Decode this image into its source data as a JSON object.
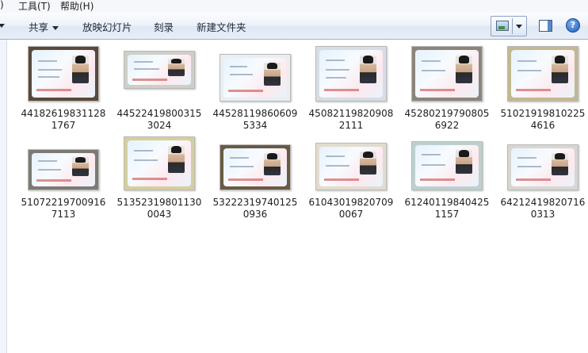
{
  "menu": [
    ")",
    "工具(T)",
    "帮助(H)"
  ],
  "toolbar": {
    "share_label": "共享",
    "slideshow_label": "放映幻灯片",
    "burn_label": "刻录",
    "new_folder_label": "新建文件夹",
    "help_glyph": "?"
  },
  "files": [
    {
      "name": "441826198311281767"
    },
    {
      "name": "445224198003153024"
    },
    {
      "name": "445281198606095334"
    },
    {
      "name": "450821198209082111"
    },
    {
      "name": "452802197908056922"
    },
    {
      "name": "510219198102254616"
    },
    {
      "name": "510722197009167113"
    },
    {
      "name": "513523198011300043"
    },
    {
      "name": "532223197401250936"
    },
    {
      "name": "610430198207090067"
    },
    {
      "name": "612401198404251157"
    },
    {
      "name": "642124198207160313"
    }
  ],
  "colors": {
    "toolbar_bg": "#e7eef8",
    "toolbar_border": "#a0b0c6",
    "text": "#1e1e1e"
  },
  "icons": [
    "chevron-down-icon",
    "view-mode-icon",
    "preview-pane-icon",
    "help-icon"
  ]
}
